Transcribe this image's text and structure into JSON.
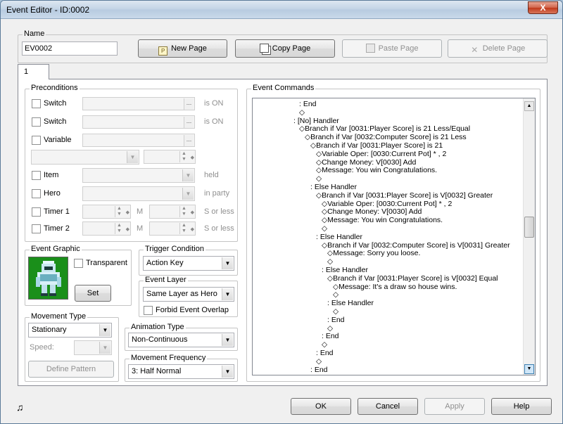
{
  "window": {
    "title": "Event Editor - ID:0002",
    "close_glyph": "X"
  },
  "name_group": {
    "label": "Name",
    "value": "EV0002"
  },
  "page_buttons": {
    "new_page": "New Page",
    "copy_page": "Copy Page",
    "paste_page": "Paste Page",
    "delete_page": "Delete Page"
  },
  "tabs": [
    {
      "label": "1"
    }
  ],
  "preconditions": {
    "label": "Preconditions",
    "switch1": {
      "label": "Switch",
      "suffix": "is ON"
    },
    "switch2": {
      "label": "Switch",
      "suffix": "is ON"
    },
    "variable": {
      "label": "Variable"
    },
    "item": {
      "label": "Item",
      "suffix": "held"
    },
    "hero": {
      "label": "Hero",
      "suffix": "in party"
    },
    "timer1": {
      "label": "Timer 1",
      "unit_m": "M",
      "suffix": "S or less"
    },
    "timer2": {
      "label": "Timer 2",
      "unit_m": "M",
      "suffix": "S or less"
    }
  },
  "event_graphic": {
    "label": "Event Graphic",
    "transparent_label": "Transparent",
    "set_button": "Set",
    "sprite_icon": "armored-hero-sprite"
  },
  "trigger_condition": {
    "label": "Trigger Condition",
    "value": "Action Key"
  },
  "event_layer": {
    "label": "Event Layer",
    "value": "Same Layer as Hero",
    "forbid_label": "Forbid Event Overlap"
  },
  "movement_type": {
    "label": "Movement Type",
    "value": "Stationary",
    "speed_label": "Speed:",
    "define_pattern": "Define Pattern"
  },
  "animation_type": {
    "label": "Animation Type",
    "value": "Non-Continuous"
  },
  "movement_frequency": {
    "label": "Movement Frequency",
    "value": "3: Half Normal"
  },
  "event_commands": {
    "label": "Event Commands",
    "lines": [
      ": End",
      "◇",
      ": [No] Handler",
      "◇Branch if Var [0031:Player Score] is 21 Less/Equal",
      "◇Branch if Var [0032:Computer Score] is 21 Less",
      "◇Branch if Var [0031:Player Score] is 21",
      "◇Variable Oper: [0030:Current Pot] * , 2",
      "◇Change Money: V[0030] Add",
      "◇Message: You win Congratulations.",
      "◇",
      ": Else Handler",
      "◇Branch if Var [0031:Player Score] is V[0032] Greater",
      "◇Variable Oper: [0030:Current Pot] * , 2",
      "◇Change Money: V[0030] Add",
      "◇Message: You win Congratulations.",
      "◇",
      ": Else Handler",
      "◇Branch if Var [0032:Computer Score] is V[0031] Greater",
      "◇Message: Sorry you loose.",
      "◇",
      ": Else Handler",
      "◇Branch if Var [0031:Player Score] is V[0032] Equal",
      "◇Message: It's a draw so house wins.",
      "◇",
      ": Else Handler",
      "◇",
      ": End",
      "◇",
      ": End",
      "◇",
      ": End",
      "◇",
      ": End"
    ],
    "indents": [
      9,
      9,
      8,
      9,
      10,
      11,
      12,
      12,
      12,
      12,
      11,
      12,
      13,
      13,
      13,
      13,
      12,
      13,
      14,
      14,
      13,
      14,
      15,
      15,
      14,
      15,
      14,
      14,
      13,
      13,
      12,
      12,
      11
    ]
  },
  "footer": {
    "music_icon": "music-note-icon",
    "ok": "OK",
    "cancel": "Cancel",
    "apply": "Apply",
    "help": "Help"
  }
}
